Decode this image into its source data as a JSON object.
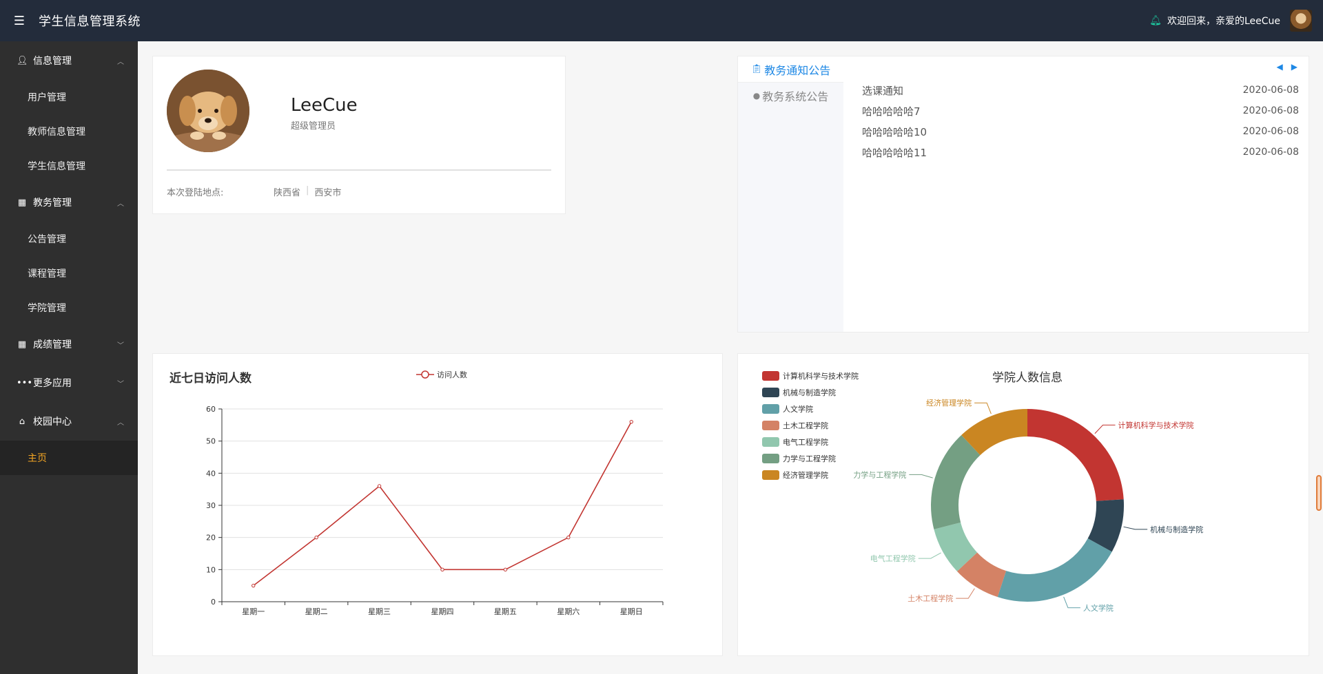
{
  "header": {
    "title": "学生信息管理系统",
    "welcome": "欢迎回来，亲爱的LeeCue"
  },
  "sidebar": {
    "groups": [
      {
        "label": "信息管理",
        "items": [
          "用户管理",
          "教师信息管理",
          "学生信息管理"
        ]
      },
      {
        "label": "教务管理",
        "items": [
          "公告管理",
          "课程管理",
          "学院管理"
        ]
      },
      {
        "label": "成绩管理",
        "items": []
      },
      {
        "label": "更多应用",
        "items": []
      },
      {
        "label": "校园中心",
        "items": [
          "主页"
        ]
      }
    ]
  },
  "profile": {
    "name": "LeeCue",
    "role": "超级管理员",
    "location_label": "本次登陆地点:",
    "province": "陕西省",
    "city": "西安市"
  },
  "notice": {
    "tabs": [
      "教务通知公告",
      "教务系统公告"
    ],
    "items": [
      {
        "title": "选课通知",
        "date": "2020-06-08"
      },
      {
        "title": "哈哈哈哈哈7",
        "date": "2020-06-08"
      },
      {
        "title": "哈哈哈哈哈10",
        "date": "2020-06-08"
      },
      {
        "title": "哈哈哈哈哈11",
        "date": "2020-06-08"
      }
    ]
  },
  "visits": {
    "title": "近七日访问人数",
    "chart_data": {
      "type": "line",
      "categories": [
        "星期一",
        "星期二",
        "星期三",
        "星期四",
        "星期五",
        "星期六",
        "星期日"
      ],
      "series": [
        {
          "name": "访问人数",
          "values": [
            5,
            20,
            36,
            10,
            10,
            20,
            56
          ]
        }
      ],
      "ylim": [
        0,
        60
      ],
      "yticks": [
        0,
        10,
        20,
        30,
        40,
        50,
        60
      ],
      "grid": true,
      "legend": "top",
      "color": "#c23531"
    }
  },
  "colleges": {
    "chart_data": {
      "type": "pie",
      "title": "学院人数信息",
      "labels": [
        "计算机科学与技术学院",
        "机械与制造学院",
        "人文学院",
        "土木工程学院",
        "电气工程学院",
        "力学与工程学院",
        "经济管理学院"
      ],
      "values": [
        24,
        9,
        22,
        8,
        8,
        17,
        12
      ],
      "colors": [
        "#c23531",
        "#2f4554",
        "#61a0a8",
        "#d48265",
        "#91c7ae",
        "#749f83",
        "#ca8622"
      ],
      "donut": true,
      "legend": "left"
    }
  }
}
